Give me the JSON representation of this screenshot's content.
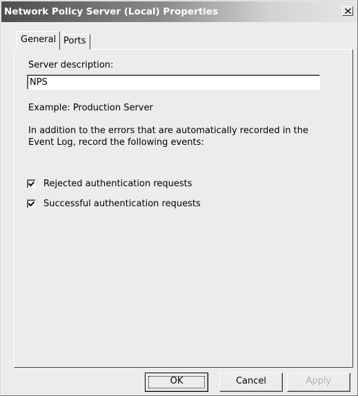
{
  "window": {
    "title": "Network Policy Server (Local) Properties",
    "close_icon": "close-icon"
  },
  "tabs": [
    {
      "label": "General",
      "selected": true
    },
    {
      "label": "Ports",
      "selected": false
    }
  ],
  "general": {
    "server_description_label": "Server description:",
    "server_description_value": "NPS",
    "example_text": "Example: Production Server",
    "info_text": "In addition to the errors that are automatically recorded in the Event Log, record the following events:",
    "checkboxes": [
      {
        "label": "Rejected authentication requests",
        "checked": true
      },
      {
        "label": "Successful authentication requests",
        "checked": true
      }
    ]
  },
  "buttons": {
    "ok": "OK",
    "cancel": "Cancel",
    "apply": "Apply",
    "apply_disabled": true
  },
  "colors": {
    "dialog_background": "#ececec",
    "titlebar_start": "#4d4d4d",
    "titlebar_end": "#e6e6e6",
    "disabled_text": "#a8a8a8"
  }
}
